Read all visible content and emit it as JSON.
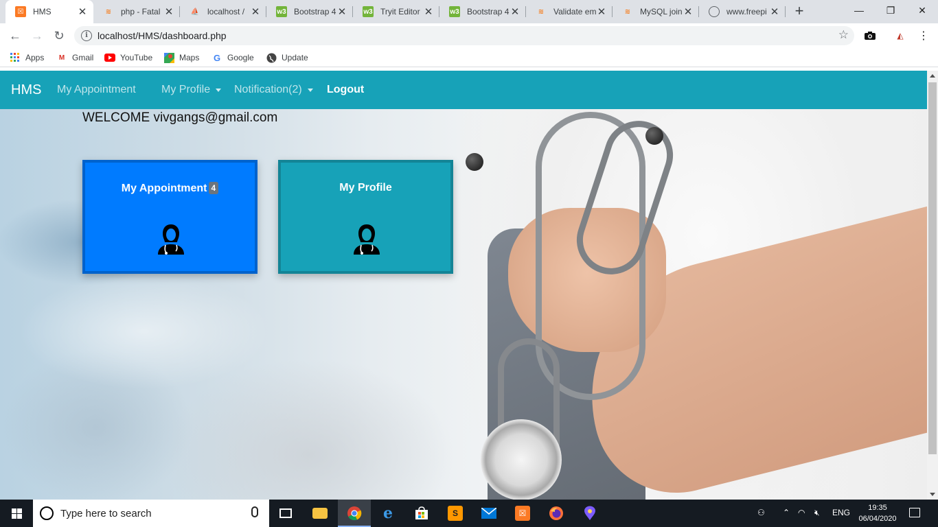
{
  "browser": {
    "tabs": [
      {
        "title": "HMS",
        "active": true,
        "icon": "xampp-icon",
        "color": "#fb7a24"
      },
      {
        "title": "php - Fatal",
        "active": false,
        "icon": "stackoverflow-icon",
        "color": "#f48024"
      },
      {
        "title": "localhost /",
        "active": false,
        "icon": "phpmyadmin-icon",
        "color": "#f89c0e"
      },
      {
        "title": "Bootstrap 4",
        "active": false,
        "icon": "w3schools-icon",
        "color": "#73b43a"
      },
      {
        "title": "Tryit Editor",
        "active": false,
        "icon": "w3schools-icon",
        "color": "#73b43a"
      },
      {
        "title": "Bootstrap 4",
        "active": false,
        "icon": "w3schools-icon",
        "color": "#73b43a"
      },
      {
        "title": "Validate em",
        "active": false,
        "icon": "stackoverflow-icon",
        "color": "#f48024"
      },
      {
        "title": "MySQL join",
        "active": false,
        "icon": "stackoverflow-icon",
        "color": "#f48024"
      },
      {
        "title": "www.freepi",
        "active": false,
        "icon": "globe-icon",
        "color": "#5f6368"
      }
    ],
    "url": "localhost/HMS/dashboard.php",
    "bookmarks": [
      {
        "label": "Apps",
        "icon": "apps-grid-icon"
      },
      {
        "label": "Gmail",
        "icon": "gmail-icon"
      },
      {
        "label": "YouTube",
        "icon": "youtube-icon"
      },
      {
        "label": "Maps",
        "icon": "maps-icon"
      },
      {
        "label": "Google",
        "icon": "google-icon"
      },
      {
        "label": "Update",
        "icon": "globe-icon"
      }
    ]
  },
  "site": {
    "brand": "HMS",
    "nav": {
      "appointment": "My Appointment",
      "profile": "My Profile",
      "notification": "Notification(2)",
      "logout": "Logout"
    },
    "welcome": "WELCOME vivgangs@gmail.com",
    "cards": {
      "appointment": {
        "title": "My Appointment",
        "badge": "4",
        "color": "#007bff"
      },
      "profile": {
        "title": "My Profile",
        "color": "#17a2b8"
      }
    },
    "colors": {
      "navbar": "#17a2b8",
      "primary": "#007bff",
      "info": "#17a2b8"
    }
  },
  "taskbar": {
    "search_placeholder": "Type here to search",
    "apps": [
      "task-view-icon",
      "file-explorer-icon",
      "chrome-icon",
      "edge-icon",
      "store-icon",
      "sublime-icon",
      "mail-icon",
      "xampp-icon",
      "firefox-icon",
      "maps-pin-icon"
    ],
    "language": "ENG",
    "time": "19:35",
    "date": "06/04/2020"
  }
}
